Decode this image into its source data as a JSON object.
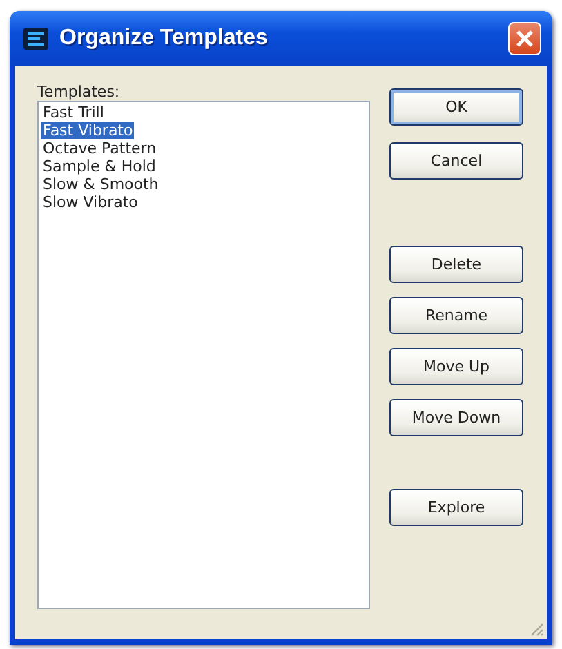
{
  "window": {
    "title": "Organize Templates"
  },
  "templates": {
    "label": "Templates:",
    "items": [
      {
        "name": "Fast Trill",
        "selected": false
      },
      {
        "name": "Fast Vibrato",
        "selected": true
      },
      {
        "name": "Octave Pattern",
        "selected": false
      },
      {
        "name": "Sample & Hold",
        "selected": false
      },
      {
        "name": "Slow & Smooth",
        "selected": false
      },
      {
        "name": "Slow Vibrato",
        "selected": false
      }
    ]
  },
  "button_groups": [
    [
      {
        "label": "OK",
        "default": true
      },
      {
        "label": "Cancel",
        "default": false
      }
    ],
    [
      {
        "label": "Delete",
        "default": false
      },
      {
        "label": "Rename",
        "default": false
      },
      {
        "label": "Move Up",
        "default": false
      },
      {
        "label": "Move Down",
        "default": false
      }
    ],
    [
      {
        "label": "Explore",
        "default": false
      }
    ]
  ]
}
